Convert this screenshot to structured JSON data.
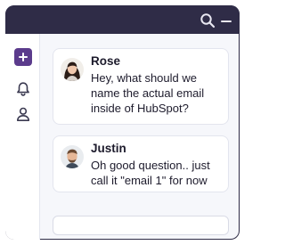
{
  "titlebar": {
    "search_icon": "search-icon",
    "minimize_icon": "minimize-icon"
  },
  "sidebar": {
    "items": [
      {
        "icon": "plus-icon",
        "color": "#5b3b8c"
      },
      {
        "icon": "bell-icon"
      },
      {
        "icon": "person-icon"
      }
    ]
  },
  "messages": [
    {
      "author": "Rose",
      "text": "Hey, what should we name the actual email inside of HubSpot?"
    },
    {
      "author": "Justin",
      "text": "Oh good question.. just call it \"email 1\" for now"
    }
  ],
  "composer": {
    "placeholder": ""
  },
  "colors": {
    "titlebar": "#2f2c47",
    "accent": "#5b3b8c",
    "background": "#f6f7fb"
  }
}
